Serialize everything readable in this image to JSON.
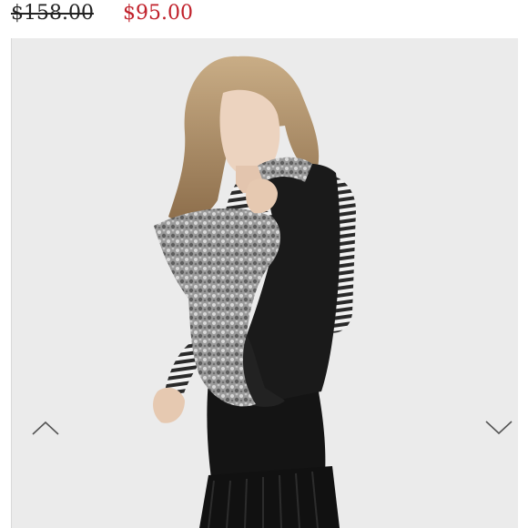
{
  "listing": {
    "original_price": "$158.00",
    "sale_price": "$95.00"
  },
  "gallery": {
    "previous_icon": "chevron-up-icon",
    "next_icon": "chevron-down-icon"
  },
  "colors": {
    "sale_price": "#c0202a",
    "background": "#ececec"
  }
}
